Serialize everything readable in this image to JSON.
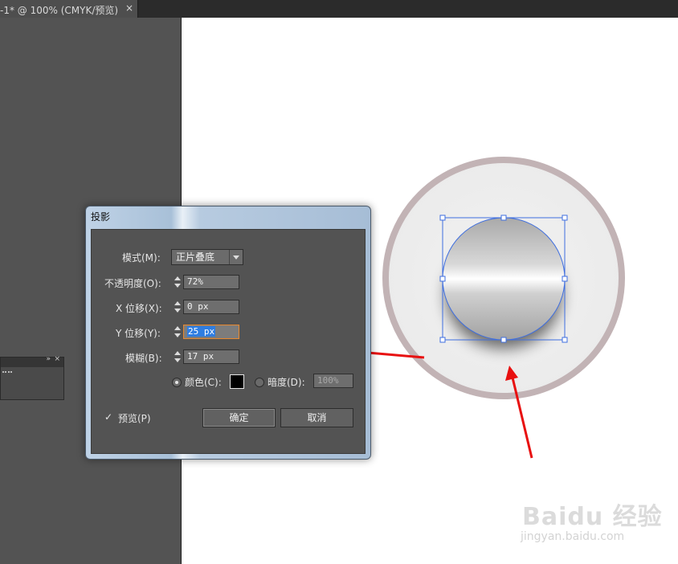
{
  "document": {
    "tab_title": "-1* @ 100% (CMYK/预览)",
    "close_glyph": "×"
  },
  "panel": {
    "arrows_glyph": "»",
    "close_glyph": "×"
  },
  "dialog": {
    "title": "投影",
    "mode": {
      "label": "模式(M):",
      "value": "正片叠底"
    },
    "opacity": {
      "label": "不透明度(O):",
      "value": "72%"
    },
    "x_offset": {
      "label": "X 位移(X):",
      "value": "0 px"
    },
    "y_offset": {
      "label": "Y 位移(Y):",
      "value": "25 px"
    },
    "blur": {
      "label": "模糊(B):",
      "value": "17 px"
    },
    "color": {
      "label": "颜色(C):",
      "swatch": "#000000",
      "selected": true
    },
    "darkness": {
      "label": "暗度(D):",
      "value": "100%",
      "selected": false
    },
    "preview": {
      "label": "预览(P)",
      "checked": true
    },
    "ok_label": "确定",
    "cancel_label": "取消"
  },
  "watermark": {
    "text": "Baidu 经验",
    "sub": "jingyan.baidu.com"
  },
  "colors": {
    "ring": "#c2b3b5",
    "plate": "#efefef",
    "selection": "#3e6ee0",
    "arrow": "#e81010",
    "active_border": "#e8892f"
  }
}
